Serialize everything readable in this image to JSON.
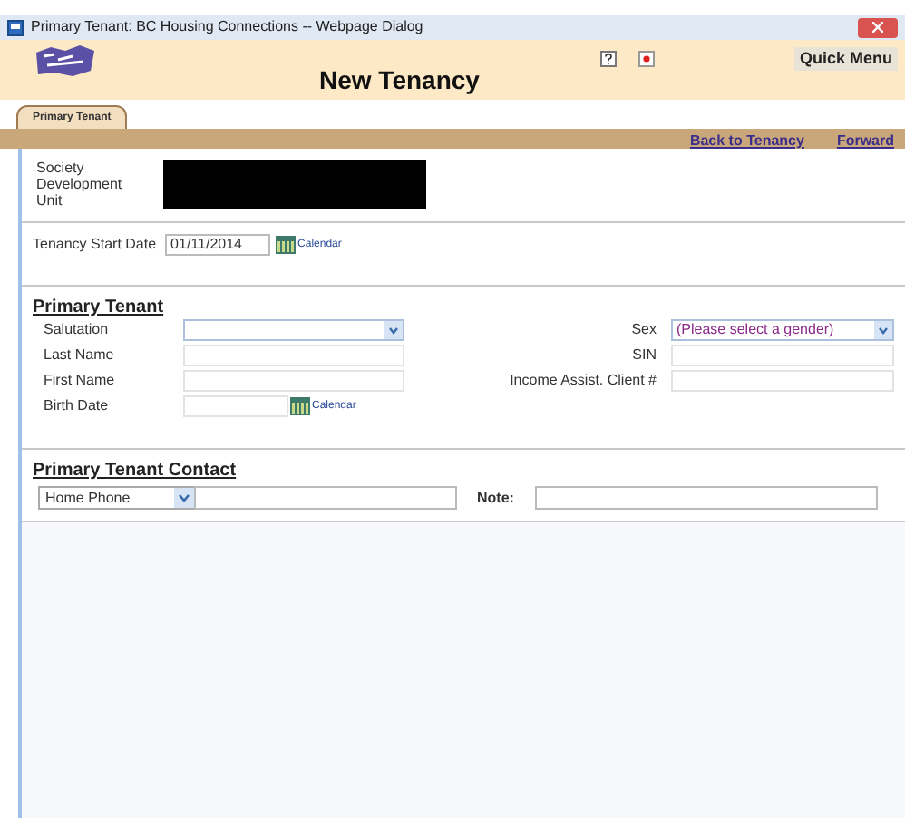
{
  "window": {
    "title": "Primary Tenant: BC Housing Connections -- Webpage Dialog"
  },
  "header": {
    "title": "New Tenancy",
    "quick_menu": "Quick Menu"
  },
  "tabs": [
    {
      "label": "Primary Tenant",
      "selected": true
    }
  ],
  "nav_links": [
    "Back to Tenancy",
    "Forward"
  ],
  "society": {
    "label": "Society Development Unit"
  },
  "tenancy_start": {
    "label": "Tenancy Start Date",
    "value": "01/11/2014",
    "calendar": "Calendar"
  },
  "primary_tenant": {
    "heading": "Primary Tenant",
    "left_fields": [
      {
        "label": "Salutation",
        "kind": "select"
      },
      {
        "label": "Last Name",
        "kind": "text"
      },
      {
        "label": "First Name",
        "kind": "text"
      },
      {
        "label": "Birth Date",
        "kind": "date",
        "calendar": "Calendar"
      }
    ],
    "right_fields": [
      {
        "label": "Sex",
        "kind": "select",
        "value": "(Please select a gender)"
      },
      {
        "label": "SIN",
        "kind": "text"
      },
      {
        "label": "Income Assist. Client #",
        "kind": "text"
      }
    ]
  },
  "contact": {
    "heading": "Primary Tenant Contact",
    "type": "Home Phone",
    "note_label": "Note:"
  }
}
